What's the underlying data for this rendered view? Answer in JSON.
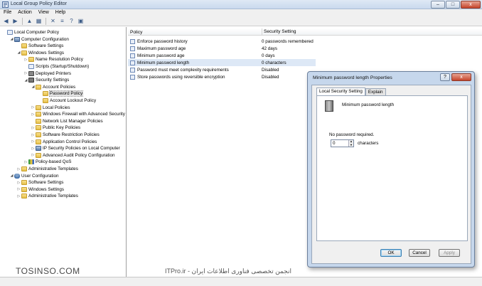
{
  "window": {
    "title": "Local Group Policy Editor",
    "btn_min": "–",
    "btn_max": "□",
    "btn_close": "x"
  },
  "menu": [
    "File",
    "Action",
    "View",
    "Help"
  ],
  "toolbar": {
    "back": "◀",
    "forward": "▶",
    "up": "▲",
    "show_hide": "▦",
    "delete": "✕",
    "properties": "≡",
    "help": "?",
    "view": "▣"
  },
  "tree": [
    {
      "label": "Local Computer Policy",
      "icon": "doc",
      "indent": 0,
      "exp": ""
    },
    {
      "label": "Computer Configuration",
      "icon": "pc",
      "indent": 1,
      "exp": "◢"
    },
    {
      "label": "Software Settings",
      "icon": "folder",
      "indent": 2,
      "exp": ""
    },
    {
      "label": "Windows Settings",
      "icon": "folder",
      "indent": 2,
      "exp": "◢"
    },
    {
      "label": "Name Resolution Policy",
      "icon": "folder",
      "indent": 3,
      "exp": "▷"
    },
    {
      "label": "Scripts (Startup/Shutdown)",
      "icon": "doc",
      "indent": 3,
      "exp": ""
    },
    {
      "label": "Deployed Printers",
      "icon": "printer",
      "indent": 3,
      "exp": "▷"
    },
    {
      "label": "Security Settings",
      "icon": "lock",
      "indent": 3,
      "exp": "◢"
    },
    {
      "label": "Account Policies",
      "icon": "folder",
      "indent": 4,
      "exp": "◢"
    },
    {
      "label": "Password Policy",
      "icon": "folder",
      "indent": 5,
      "exp": "",
      "selected": true
    },
    {
      "label": "Account Lockout Policy",
      "icon": "folder",
      "indent": 5,
      "exp": ""
    },
    {
      "label": "Local Policies",
      "icon": "folder",
      "indent": 4,
      "exp": "▷"
    },
    {
      "label": "Windows Firewall with Advanced Security",
      "icon": "folder",
      "indent": 4,
      "exp": "▷"
    },
    {
      "label": "Network List Manager Policies",
      "icon": "folder",
      "indent": 4,
      "exp": ""
    },
    {
      "label": "Public Key Policies",
      "icon": "folder",
      "indent": 4,
      "exp": "▷"
    },
    {
      "label": "Software Restriction Policies",
      "icon": "folder",
      "indent": 4,
      "exp": "▷"
    },
    {
      "label": "Application Control Policies",
      "icon": "folder",
      "indent": 4,
      "exp": "▷"
    },
    {
      "label": "IP Security Policies on Local Computer",
      "icon": "pc",
      "indent": 4,
      "exp": "▷"
    },
    {
      "label": "Advanced Audit Policy Configuration",
      "icon": "folder",
      "indent": 4,
      "exp": "▷"
    },
    {
      "label": "Policy-based QoS",
      "icon": "chart",
      "indent": 3,
      "exp": "▷"
    },
    {
      "label": "Administrative Templates",
      "icon": "folder",
      "indent": 2,
      "exp": "▷"
    },
    {
      "label": "User Configuration",
      "icon": "user",
      "indent": 1,
      "exp": "◢"
    },
    {
      "label": "Software Settings",
      "icon": "folder",
      "indent": 2,
      "exp": "▷"
    },
    {
      "label": "Windows Settings",
      "icon": "folder",
      "indent": 2,
      "exp": "▷"
    },
    {
      "label": "Administrative Templates",
      "icon": "folder",
      "indent": 2,
      "exp": "▷"
    }
  ],
  "list": {
    "col_policy": "Policy",
    "col_setting": "Security Setting",
    "rows": [
      {
        "policy": "Enforce password history",
        "setting": "0 passwords remembered"
      },
      {
        "policy": "Maximum password age",
        "setting": "42 days"
      },
      {
        "policy": "Minimum password age",
        "setting": "0 days"
      },
      {
        "policy": "Minimum password length",
        "setting": "0 characters",
        "selected": true
      },
      {
        "policy": "Password must meet complexity requirements",
        "setting": "Disabled"
      },
      {
        "policy": "Store passwords using reversible encryption",
        "setting": "Disabled"
      }
    ]
  },
  "dialog": {
    "title": "Minimum password length Properties",
    "help_btn": "?",
    "close_btn": "x",
    "tab_local": "Local Security Setting",
    "tab_explain": "Explain",
    "policy_name": "Minimum password length",
    "description": "No password required.",
    "value": "0",
    "unit": "characters",
    "ok": "OK",
    "cancel": "Cancel",
    "apply": "Apply"
  },
  "watermark": {
    "left": "TOSINSO.COM",
    "right": "ITPro.ir - انجمن تخصصی فناوری اطلاعات ایران"
  }
}
